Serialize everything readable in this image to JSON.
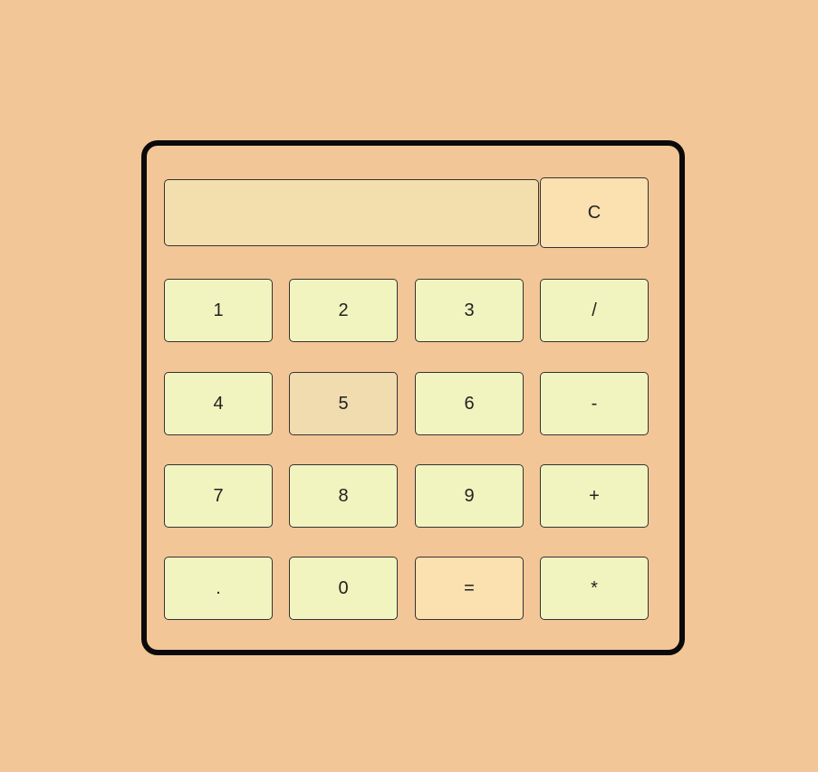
{
  "calculator": {
    "display_value": "",
    "clear_label": "C",
    "keys": {
      "k1": "1",
      "k2": "2",
      "k3": "3",
      "divide": "/",
      "k4": "4",
      "k5": "5",
      "k6": "6",
      "subtract": "-",
      "k7": "7",
      "k8": "8",
      "k9": "9",
      "add": "+",
      "decimal": ".",
      "k0": "0",
      "equals": "=",
      "multiply": "*"
    }
  },
  "colors": {
    "page_background": "#f3c697",
    "key_background": "#f2f4bf",
    "key_hover": "#f1dcb0",
    "key_accent": "#fbe0b0",
    "display_background": "#f3dfae",
    "frame_border": "#0a0a0a"
  }
}
